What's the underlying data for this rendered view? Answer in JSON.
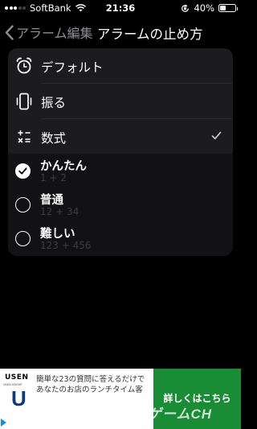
{
  "status_bar": {
    "carrier": "SoftBank",
    "time": "21:36",
    "battery": "40%",
    "battery_level": 0.4,
    "icons": [
      "signal-icon",
      "wifi-icon",
      "orientation-lock-icon",
      "battery-icon"
    ]
  },
  "nav": {
    "back_label": "アラーム編集",
    "title": "アラームの止め方"
  },
  "options": [
    {
      "label": "デフォルト",
      "icon": "alarm-clock-icon"
    },
    {
      "label": "振る",
      "icon": "phone-shake-icon"
    },
    {
      "label": "数式",
      "icon": "math-symbols-icon",
      "checked": true
    }
  ],
  "difficulty": [
    {
      "title": "かんたん",
      "detail": "1 + 2",
      "selected": true
    },
    {
      "title": "普通",
      "detail": "12 + 34",
      "selected": false
    },
    {
      "title": "難しい",
      "detail": "123 + 456",
      "selected": false
    }
  ],
  "ad": {
    "brand": "USEN",
    "brand_sub": "USEN GROUP",
    "logo_letter": "U",
    "text": "簡単な23の質問に答えるだけであなたのお店のランチタイム客",
    "button": "詳しくはこちら"
  },
  "watermark": "ゲームCH",
  "colors": {
    "background": "#000000",
    "card": "#1c1c1e",
    "sub_card": "#121214",
    "secondary_text": "#8e8e93",
    "ad_button": "#1a8c35",
    "ad_logo": "#0a3b7a"
  }
}
